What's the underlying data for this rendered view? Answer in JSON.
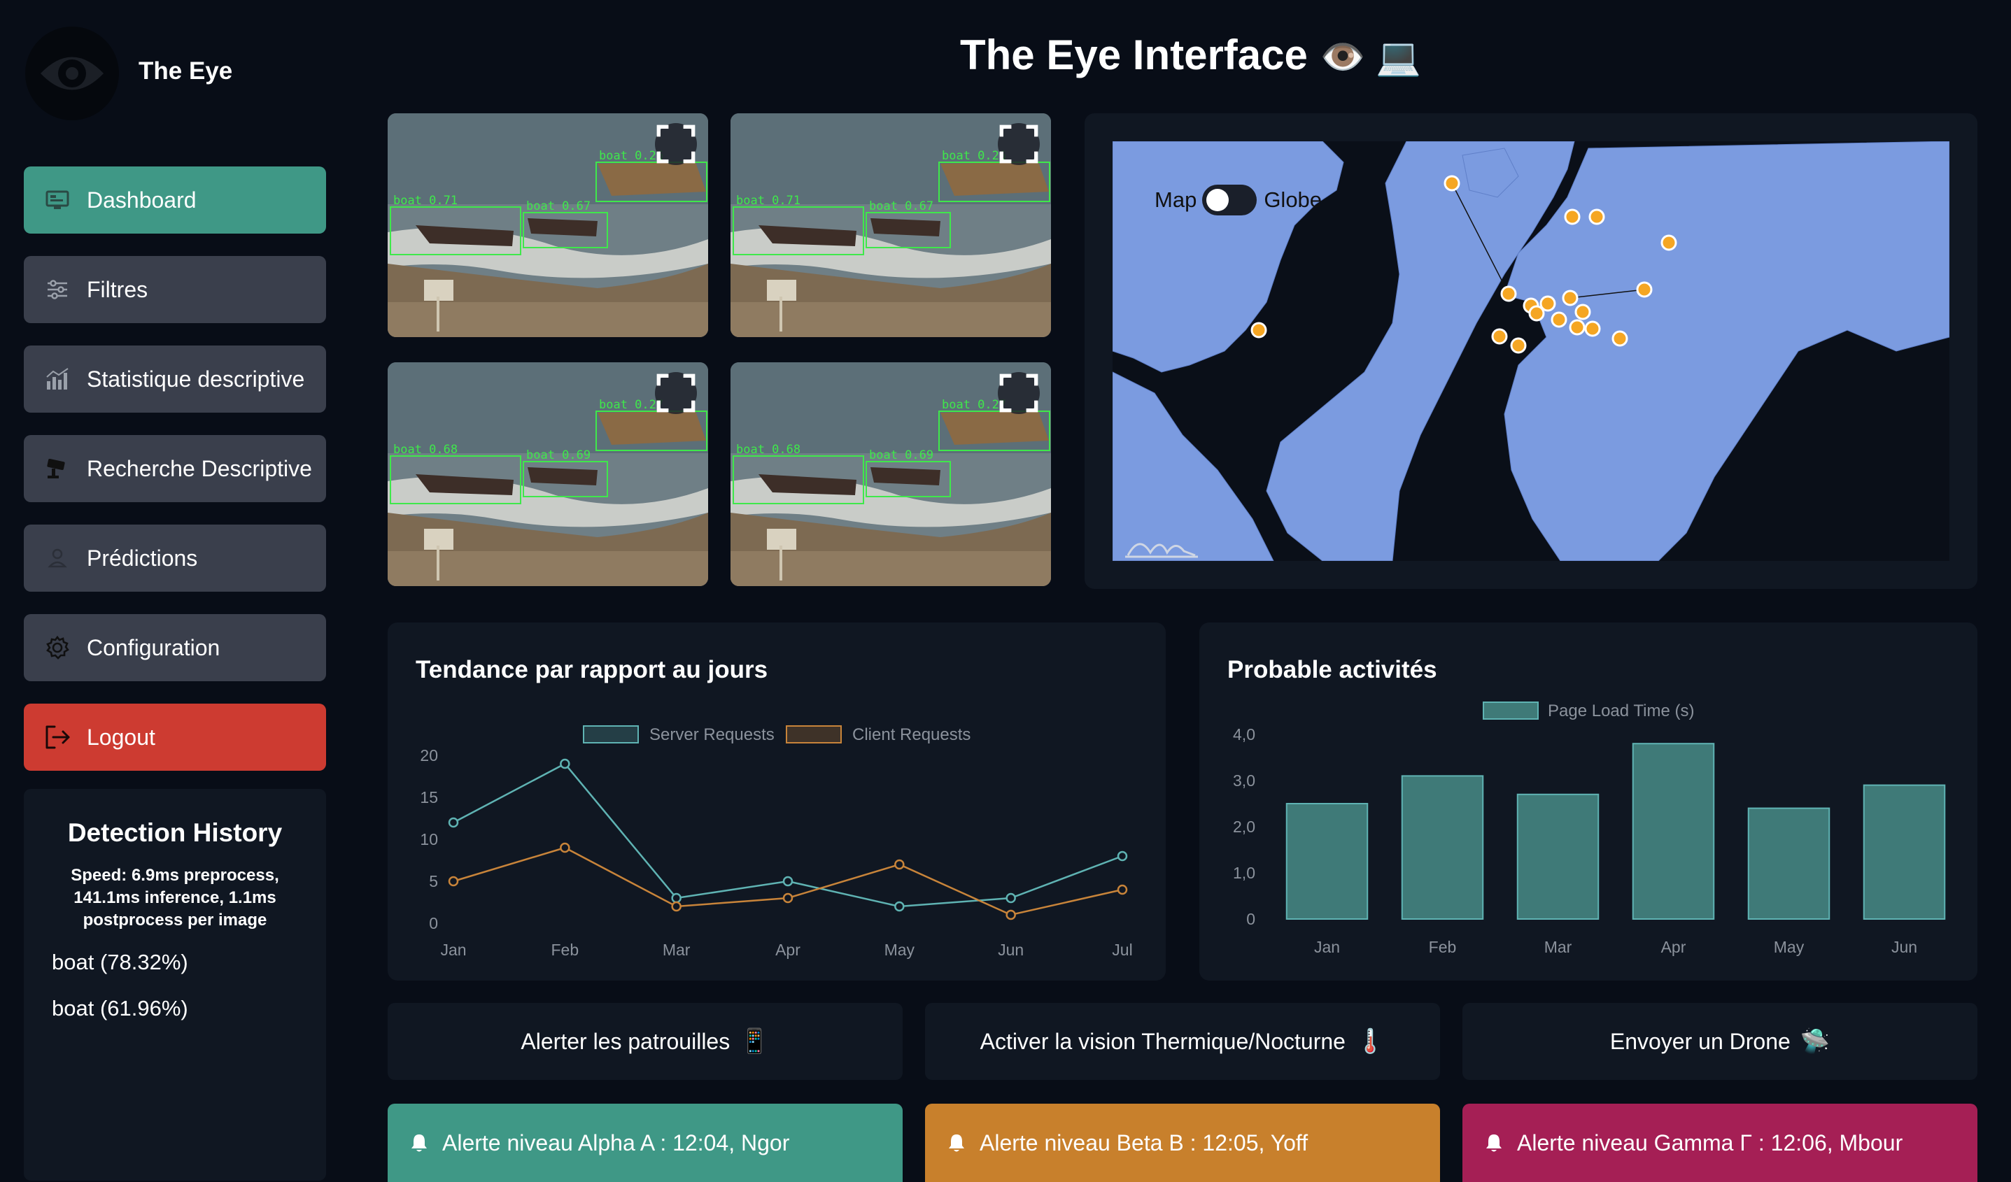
{
  "app": {
    "brand": "The Eye",
    "title": "The Eye Interface",
    "title_emoji": "👁️ 💻"
  },
  "sidebar": {
    "items": [
      {
        "label": "Dashboard",
        "icon": "dashboard-icon",
        "active": true
      },
      {
        "label": "Filtres",
        "icon": "sliders-icon"
      },
      {
        "label": "Statistique descriptive",
        "icon": "bar-chart-icon"
      },
      {
        "label": "Recherche Descriptive",
        "icon": "camera-icon"
      },
      {
        "label": "Prédictions",
        "icon": "user-icon"
      },
      {
        "label": "Configuration",
        "icon": "gear-icon"
      }
    ],
    "logout": "Logout"
  },
  "detection_history": {
    "title": "Detection History",
    "speed": "Speed: 6.9ms preprocess, 141.1ms inference, 1.1ms postprocess per image",
    "detections": [
      "boat (78.32%)",
      "boat (61.96%)"
    ]
  },
  "video_feeds": [
    {
      "labels": [
        "boat 0.71",
        "boat 0.67",
        "boat 0.26"
      ]
    },
    {
      "labels": [
        "boat 0.71",
        "boat 0.67",
        "boat 0.26"
      ]
    },
    {
      "labels": [
        "boat 0.68",
        "boat 0.69",
        "boat 0.27"
      ]
    },
    {
      "labels": [
        "boat 0.68",
        "boat 0.69",
        "boat 0.27"
      ]
    }
  ],
  "map": {
    "toggle_left": "Map",
    "toggle_right": "Globe",
    "land_color": "#7b9be0",
    "marker_color": "#f5a623"
  },
  "trend_chart": {
    "title": "Tendance par rapport au jours",
    "chart_data": {
      "type": "line",
      "categories": [
        "Jan",
        "Feb",
        "Mar",
        "Apr",
        "May",
        "Jun",
        "Jul"
      ],
      "series": [
        {
          "name": "Server Requests",
          "values": [
            12,
            19,
            3,
            5,
            2,
            3,
            8
          ],
          "color": "#5fb3b3"
        },
        {
          "name": "Client Requests",
          "values": [
            5,
            9,
            2,
            3,
            7,
            1,
            4
          ],
          "color": "#c8843a"
        }
      ],
      "yticks": [
        "0",
        "5",
        "10",
        "15",
        "20"
      ],
      "ylim": [
        0,
        20
      ]
    }
  },
  "activity_chart": {
    "title": "Probable activités",
    "chart_data": {
      "type": "bar",
      "categories": [
        "Jan",
        "Feb",
        "Mar",
        "Apr",
        "May",
        "Jun"
      ],
      "series": [
        {
          "name": "Page Load Time (s)",
          "values": [
            2.5,
            3.1,
            2.7,
            3.8,
            2.4,
            2.9
          ],
          "color": "#3f7a78"
        }
      ],
      "yticks": [
        "0",
        "1,0",
        "2,0",
        "3,0",
        "4,0"
      ],
      "ylim": [
        0,
        4
      ]
    }
  },
  "actions": [
    {
      "label": "Alerter les patrouilles",
      "emoji": "📱"
    },
    {
      "label": "Activer la vision Thermique/Nocturne",
      "emoji": "🌡️"
    },
    {
      "label": "Envoyer un Drone",
      "emoji": "🛸"
    }
  ],
  "alerts": [
    {
      "text": "Alerte niveau Alpha A : 12:04, Ngor",
      "color": "#3f9886"
    },
    {
      "text": "Alerte niveau Beta B : 12:05, Yoff",
      "color": "#c8802c"
    },
    {
      "text": "Alerte niveau Gamma Γ : 12:06, Mbour",
      "color": "#a51f55"
    }
  ]
}
